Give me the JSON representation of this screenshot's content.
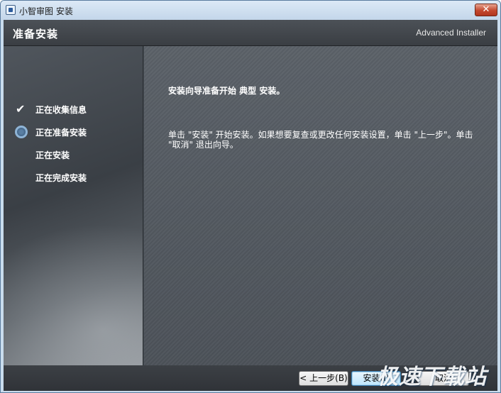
{
  "window": {
    "title": "小智审图 安装",
    "close_label": "✕"
  },
  "header": {
    "title": "准备安装",
    "brand": "Advanced Installer"
  },
  "sidebar": {
    "steps": [
      {
        "label": "正在收集信息",
        "state": "done",
        "icon": "check-icon"
      },
      {
        "label": "正在准备安装",
        "state": "current",
        "icon": "ring-icon"
      },
      {
        "label": "正在安装",
        "state": "pending",
        "icon": ""
      },
      {
        "label": "正在完成安装",
        "state": "pending",
        "icon": ""
      }
    ]
  },
  "main": {
    "heading": "安装向导准备开始 典型 安装。",
    "description": "单击 \"安装\" 开始安装。如果想要复查或更改任何安装设置，单击 \"上一步\"。单击 \"取消\" 退出向导。"
  },
  "footer": {
    "back_label": "< 上一步(B)",
    "install_label": "安装(I)",
    "cancel_label": "取消"
  },
  "watermark": "极速下载站"
}
